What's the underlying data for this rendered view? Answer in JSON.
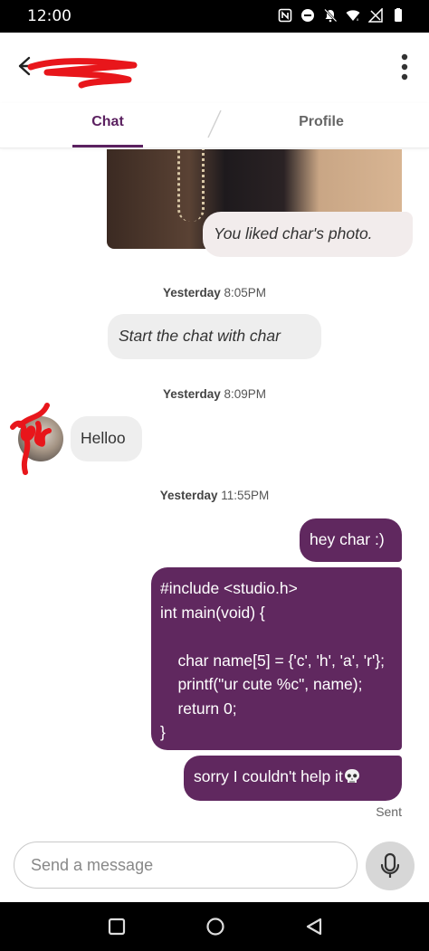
{
  "status_bar": {
    "time": "12:00",
    "icons": [
      "nfc-icon",
      "do-not-disturb-icon",
      "notifications-off-icon",
      "wifi-icon",
      "signal-off-icon",
      "battery-icon"
    ]
  },
  "header": {
    "back_icon": "back-arrow-icon",
    "contact_name_redacted": true,
    "more_icon": "more-vertical-icon"
  },
  "tabs": [
    {
      "label": "Chat",
      "active": true
    },
    {
      "label": "Profile",
      "active": false
    }
  ],
  "messages": {
    "liked_photo": "You liked char's photo.",
    "ts1": {
      "day": "Yesterday",
      "time": "8:05PM"
    },
    "start_prompt": "Start the chat with char",
    "ts2": {
      "day": "Yesterday",
      "time": "8:09PM"
    },
    "incoming_hello": "Helloo",
    "ts3": {
      "day": "Yesterday",
      "time": "11:55PM"
    },
    "outgoing_hey": "hey char :)",
    "outgoing_code": [
      "#include <studio.h>",
      "int main(void) {",
      "",
      "    char name[5] = {'c', 'h', 'a', 'r'};",
      "    printf(\"ur cute %c\", name);",
      "    return 0;",
      "}"
    ],
    "outgoing_sorry": "sorry I couldn't help it",
    "sent_status": "Sent"
  },
  "composer": {
    "placeholder": "Send a message",
    "value": "",
    "mic_icon": "microphone-icon"
  },
  "colors": {
    "accent": "#5b2160",
    "outgoing_bubble": "#60285f",
    "incoming_bubble": "#eeeeee"
  }
}
